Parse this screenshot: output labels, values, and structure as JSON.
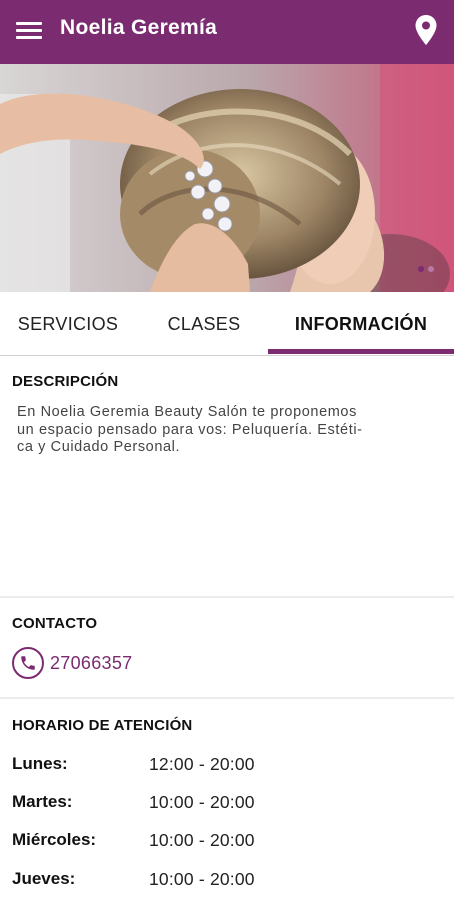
{
  "appbar": {
    "title": "Noelia Geremía",
    "menu_icon": "menu-icon",
    "location_icon": "location-pin-icon"
  },
  "hero": {
    "slides_count": 2,
    "active_slide": 1
  },
  "tabs": [
    {
      "label": "SERVICIOS",
      "active": false
    },
    {
      "label": "CLASES",
      "active": false
    },
    {
      "label": "INFORMACIÓN",
      "active": true
    }
  ],
  "description": {
    "title": "DESCRIPCIÓN",
    "line1": "En Noelia Geremia Beauty Salón te proponemos",
    "line2": "un espacio pensado para vos: Peluquería. Estéti-",
    "line3": "ca y Cuidado Personal."
  },
  "contact": {
    "title": "CONTACTO",
    "phone": "27066357",
    "phone_icon": "phone-icon"
  },
  "schedule": {
    "title": "HORARIO DE ATENCIÓN",
    "rows": [
      {
        "day": "Lunes:",
        "hours": "12:00 - 20:00"
      },
      {
        "day": "Martes:",
        "hours": "10:00 - 20:00"
      },
      {
        "day": "Miércoles:",
        "hours": "10:00 - 20:00"
      },
      {
        "day": "Jueves:",
        "hours": "10:00 - 20:00"
      }
    ]
  },
  "colors": {
    "primary": "#7b2b6f"
  }
}
